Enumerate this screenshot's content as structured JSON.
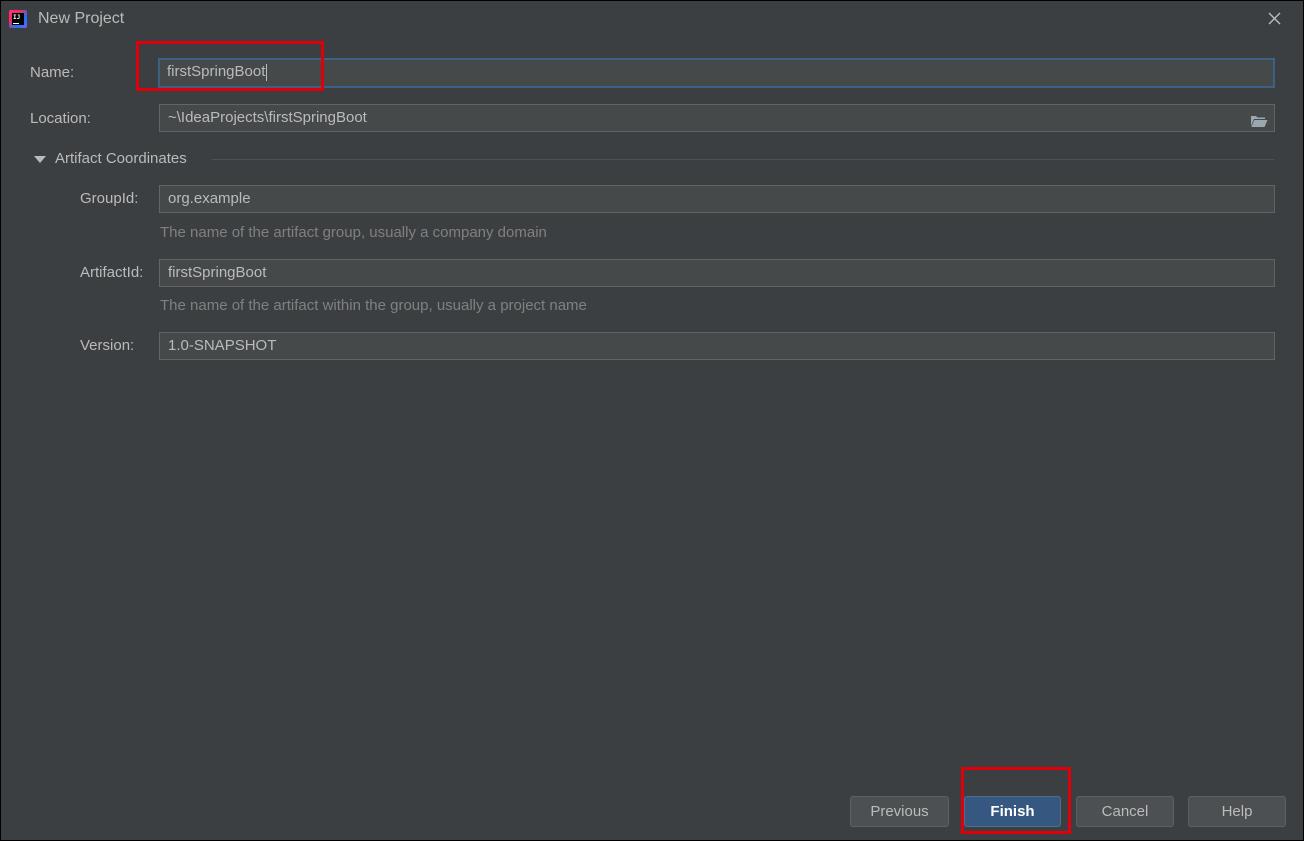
{
  "window": {
    "title": "New Project",
    "logo_text": "IJ"
  },
  "form": {
    "name_label": "Name:",
    "name_value": "firstSpringBoot",
    "location_label": "Location:",
    "location_value": "~\\IdeaProjects\\firstSpringBoot"
  },
  "artifact": {
    "section_title": "Artifact Coordinates",
    "expanded": true,
    "group_id_label": "GroupId:",
    "group_id_value": "org.example",
    "group_id_hint": "The name of the artifact group, usually a company domain",
    "artifact_id_label": "ArtifactId:",
    "artifact_id_value": "firstSpringBoot",
    "artifact_id_hint": "The name of the artifact within the group, usually a project name",
    "version_label": "Version:",
    "version_value": "1.0-SNAPSHOT"
  },
  "buttons": {
    "previous": "Previous",
    "finish": "Finish",
    "cancel": "Cancel",
    "help": "Help"
  },
  "icons": {
    "close": "close-icon",
    "folder": "folder-icon",
    "expand": "triangle-down-icon",
    "app": "intellij-idea-logo"
  },
  "colors": {
    "background": "#3c3f41",
    "field_background": "#45494a",
    "focus_border": "#3d6185",
    "primary_button": "#365880",
    "highlight": "#e0000b",
    "text": "#bbbbbb",
    "hint_text": "#808080"
  }
}
